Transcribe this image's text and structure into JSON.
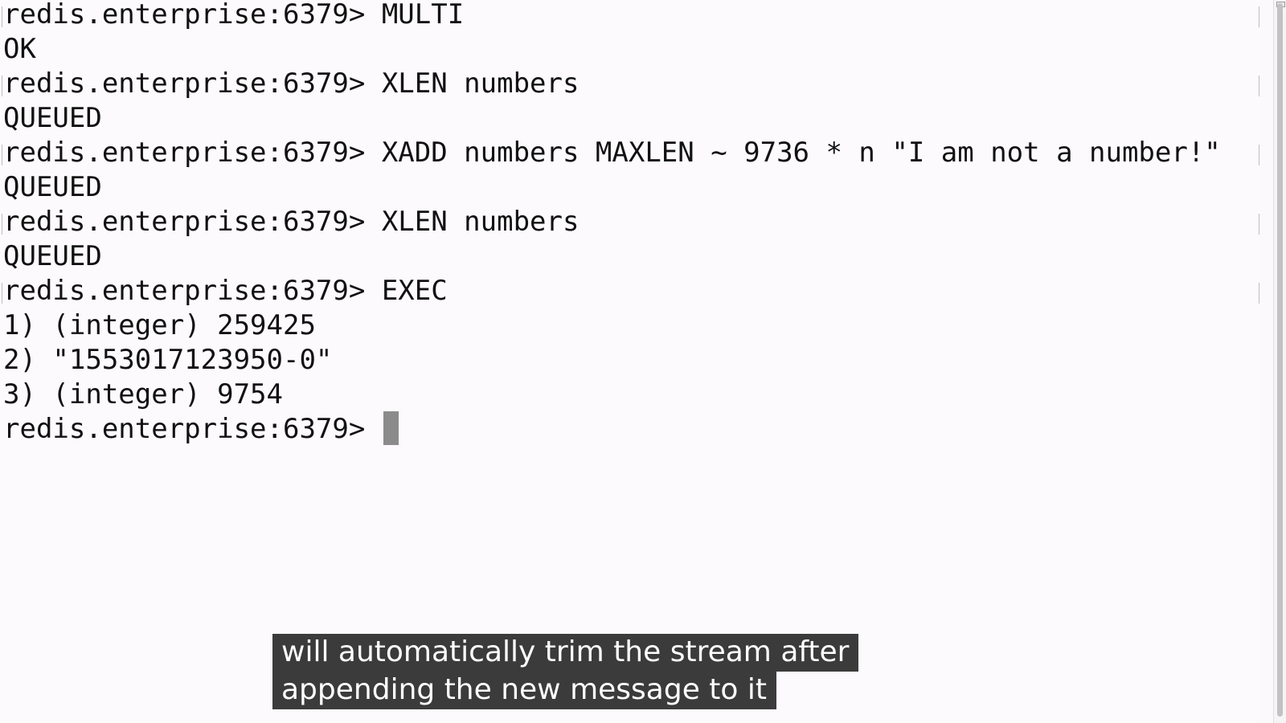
{
  "terminal": {
    "lines": [
      {
        "prompt": "redis.enterprise:6379> ",
        "text": "MULTI"
      },
      {
        "prompt": "",
        "text": "OK"
      },
      {
        "prompt": "redis.enterprise:6379> ",
        "text": "XLEN numbers"
      },
      {
        "prompt": "",
        "text": "QUEUED"
      },
      {
        "prompt": "redis.enterprise:6379> ",
        "text": "XADD numbers MAXLEN ~ 9736 * n \"I am not a number!\""
      },
      {
        "prompt": "",
        "text": "QUEUED"
      },
      {
        "prompt": "redis.enterprise:6379> ",
        "text": "XLEN numbers"
      },
      {
        "prompt": "",
        "text": "QUEUED"
      },
      {
        "prompt": "redis.enterprise:6379> ",
        "text": "EXEC"
      },
      {
        "prompt": "",
        "text": "1) (integer) 259425"
      },
      {
        "prompt": "",
        "text": "2) \"1553017123950-0\""
      },
      {
        "prompt": "",
        "text": "3) (integer) 9754"
      }
    ],
    "current_prompt": "redis.enterprise:6379> "
  },
  "captions": {
    "line1": "will automatically trim the stream after",
    "line2": "appending the new message to it"
  },
  "colors": {
    "background": "#fcfafd",
    "text": "#111111",
    "cursor": "#8b8b8b",
    "caption_bg": "#3b3b3b",
    "caption_text": "#ffffff"
  }
}
